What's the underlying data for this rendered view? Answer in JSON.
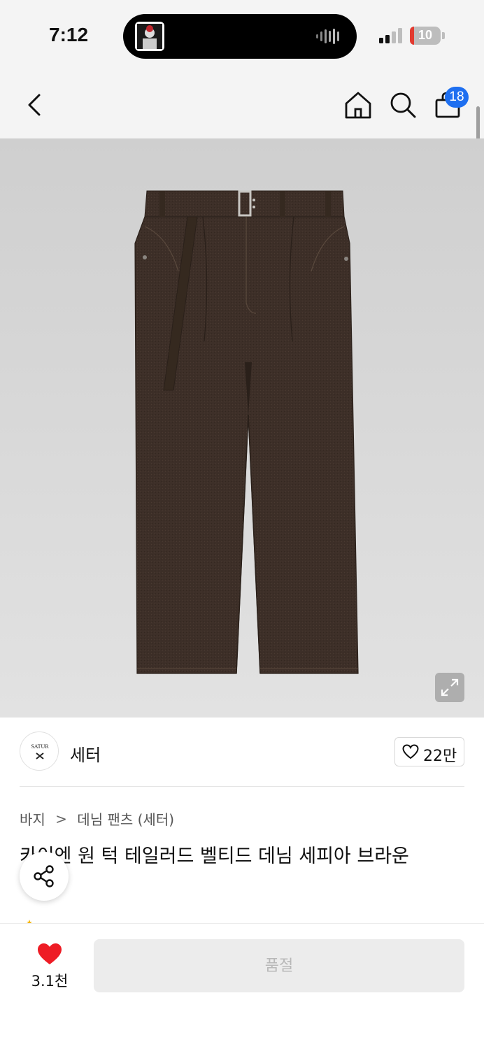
{
  "status_bar": {
    "time": "7:12",
    "battery_level": "10",
    "battery_fraction": 0.1,
    "colors": {
      "battery_low": "#e23b30"
    }
  },
  "nav": {
    "back_icon": "chevron-left-icon",
    "home_icon": "home-icon",
    "search_icon": "search-icon",
    "cart_icon": "shopping-bag-icon",
    "cart_count": "18",
    "colors": {
      "badge": "#1e6ff0"
    }
  },
  "product_image": {
    "subject": "brown belted denim pants",
    "expand_icon": "expand-icon"
  },
  "brand": {
    "name": "세터",
    "logo_text": "SATUR",
    "like_icon": "heart-outline-icon",
    "like_count": "22만"
  },
  "breadcrumb": {
    "category": "바지",
    "separator": ">",
    "subcategory": "데님 팬츠 (세터)"
  },
  "product": {
    "title": "카이엔 원 턱 테일러드 벨티드 데님 세피아 브라운"
  },
  "share": {
    "icon": "share-icon"
  },
  "bottom_bar": {
    "wish_icon": "heart-filled-icon",
    "wish_count": "3.1천",
    "soldout_label": "품절",
    "colors": {
      "heart": "#ee1c25"
    }
  }
}
